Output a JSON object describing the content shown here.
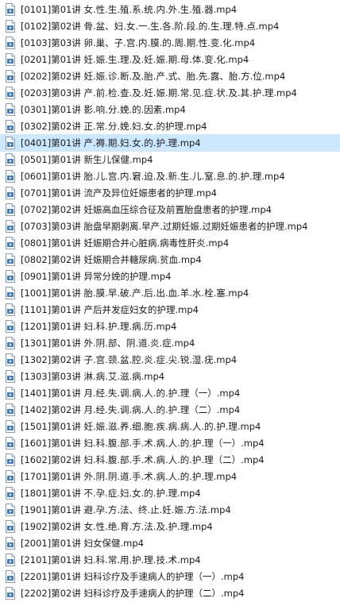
{
  "files": [
    {
      "name": "[0101]第01讲 女.性.生.殖.系.统.内.外.生.殖.器.mp4"
    },
    {
      "name": "[0102]第02讲 骨.盆、妇.女.一.生.各.阶.段.的.生.理.特.点.mp4"
    },
    {
      "name": "[0103]第03讲 卵.巢、子.宫.内.膜.的.周.期.性.变.化.mp4"
    },
    {
      "name": "[0201]第01讲 妊.娠.生.理.及.妊.娠.期.母.体.变.化.mp4"
    },
    {
      "name": "[0202]第02讲 妊.娠.诊.断.及.胎.产.式、胎.先.露、胎.方.位.mp4"
    },
    {
      "name": "[0203]第03讲 产.前.检.查.及.妊.娠.期.常.见.症.状.及.其.护.理.mp4"
    },
    {
      "name": "[0301]第01讲 影.响.分.娩.的.因素.mp4"
    },
    {
      "name": "[0302]第02讲 正.常.分.娩.妇.女.的护理.mp4"
    },
    {
      "name": "[0401]第01讲 产.褥.期.妇.女.的.护.理.mp4"
    },
    {
      "name": "[0501]第01讲 新生儿保健.mp4"
    },
    {
      "name": "[0601]第01讲 胎.儿.宫.内.窘.迫.及.新.生.儿.窒.息.的.护.理.mp4"
    },
    {
      "name": "[0701]第01讲 流产及异位妊娠患者的护理.mp4"
    },
    {
      "name": "[0702]第02讲 妊娠高血压综合征及前置胎盘患者的护理.mp4"
    },
    {
      "name": "[0703]第03讲 胎盘早期剥离.早产.过期妊娠.过期妊娠患者的护理.mp4"
    },
    {
      "name": "[0801]第01讲 妊娠期合并心脏病.病毒性肝炎.mp4"
    },
    {
      "name": "[0802]第02讲 妊娠期合并糖尿病.贫血.mp4"
    },
    {
      "name": "[0901]第01讲 异常分娩的护理.mp4"
    },
    {
      "name": "[1001]第01讲 胎.膜.早.破.产.后.出.血.羊.水.栓.塞.mp4"
    },
    {
      "name": "[1101]第01讲 产后并发症妇女的护理.mp4"
    },
    {
      "name": "[1201]第01讲 妇.科.护.理.病.历.mp4"
    },
    {
      "name": "[1301]第01讲 外.阴.部、阴.道.炎.症.mp4"
    },
    {
      "name": "[1302]第02讲 子.宫.颈.盆.腔.炎.症.尖.锐.湿.疣.mp4"
    },
    {
      "name": "[1303]第03讲 淋.病.艾.滋.病.mp4"
    },
    {
      "name": "[1401]第01讲 月.经.失.调.病.人.的.护.理（一）.mp4"
    },
    {
      "name": "[1402]第02讲 月.经.失.调.病.人.的.护.理（二）.mp4"
    },
    {
      "name": "[1501]第01讲 妊.娠.滋.养.细.胞.疾.病.病.人.的.护.理.mp4"
    },
    {
      "name": "[1601]第01讲 妇.科.腹.部.手.术.病.人.的.护.理（一）.mp4"
    },
    {
      "name": "[1602]第02讲 妇.科.腹.部.手.术.病.人.的.护.理（二）.mp4"
    },
    {
      "name": "[1701]第01讲 外.阴.阴.道.手.术.病.人.的.护.理.mp4"
    },
    {
      "name": "[1801]第01讲 不.孕.症.妇.女.的.护.理.mp4"
    },
    {
      "name": "[1901]第01讲 避.孕.方.法、终.止.妊.娠.方.法.mp4"
    },
    {
      "name": "[1902]第02讲 女.性.绝.育.方.法.及.护.理.mp4"
    },
    {
      "name": "[2001]第01讲 妇女保健.mp4"
    },
    {
      "name": "[2101]第01讲 妇.科.常.用.护.理.技.术.mp4"
    },
    {
      "name": "[2201]第01讲 妇科诊疗及手速病人的护理（一）.mp4"
    },
    {
      "name": "[2202]第02讲 妇科诊疗及手速病人的护理（二）.mp4"
    }
  ],
  "selected_index": 8,
  "colors": {
    "selection": "#cce8ff",
    "icon_blue": "#3f7fc9",
    "icon_border": "#8a9bb0"
  },
  "icon": "video-file-icon"
}
